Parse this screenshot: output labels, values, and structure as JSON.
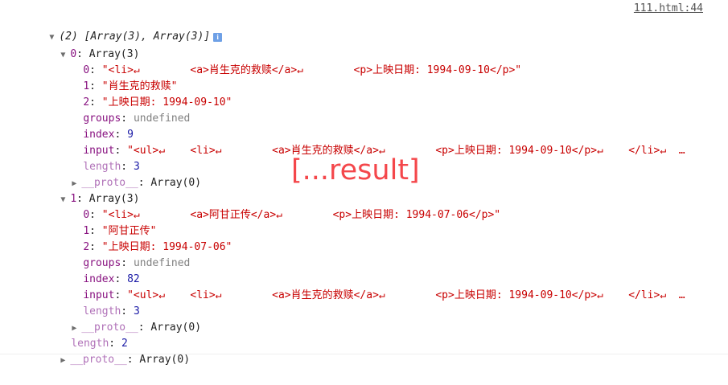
{
  "source_link": "111.html:44",
  "summary": "(2) [Array(3), Array(3)]",
  "info_icon": "i",
  "colors": {
    "property_key": "#881280",
    "string_value": "#c80000",
    "number_value": "#1a1aa6",
    "undefined_value": "#808080",
    "overlay_text": "#f4474b"
  },
  "items": [
    {
      "header_key": "0",
      "header_value": "Array(3)",
      "entries": {
        "e0_key": "0",
        "e0_val": "\"<li>↵        <a>肖生克的救赎</a>↵        <p>上映日期: 1994-09-10</p>\"",
        "e1_key": "1",
        "e1_val": "\"肖生克的救赎\"",
        "e2_key": "2",
        "e2_val": "\"上映日期: 1994-09-10\"",
        "groups_key": "groups",
        "groups_val": "undefined",
        "index_key": "index",
        "index_val": "9",
        "input_key": "input",
        "input_val": "\"<ul>↵    <li>↵        <a>肖生克的救赎</a>↵        <p>上映日期: 1994-09-10</p>↵    </li>↵  …",
        "length_key": "length",
        "length_val": "3",
        "proto_key": "__proto__",
        "proto_val": "Array(0)"
      }
    },
    {
      "header_key": "1",
      "header_value": "Array(3)",
      "entries": {
        "e0_key": "0",
        "e0_val": "\"<li>↵        <a>阿甘正传</a>↵        <p>上映日期: 1994-07-06</p>\"",
        "e1_key": "1",
        "e1_val": "\"阿甘正传\"",
        "e2_key": "2",
        "e2_val": "\"上映日期: 1994-07-06\"",
        "groups_key": "groups",
        "groups_val": "undefined",
        "index_key": "index",
        "index_val": "82",
        "input_key": "input",
        "input_val": "\"<ul>↵    <li>↵        <a>肖生克的救赎</a>↵        <p>上映日期: 1994-09-10</p>↵    </li>↵  …",
        "length_key": "length",
        "length_val": "3",
        "proto_key": "__proto__",
        "proto_val": "Array(0)"
      }
    }
  ],
  "outer_length_key": "length",
  "outer_length_val": "2",
  "outer_proto_key": "__proto__",
  "outer_proto_val": "Array(0)",
  "overlay_label": "[...result]"
}
